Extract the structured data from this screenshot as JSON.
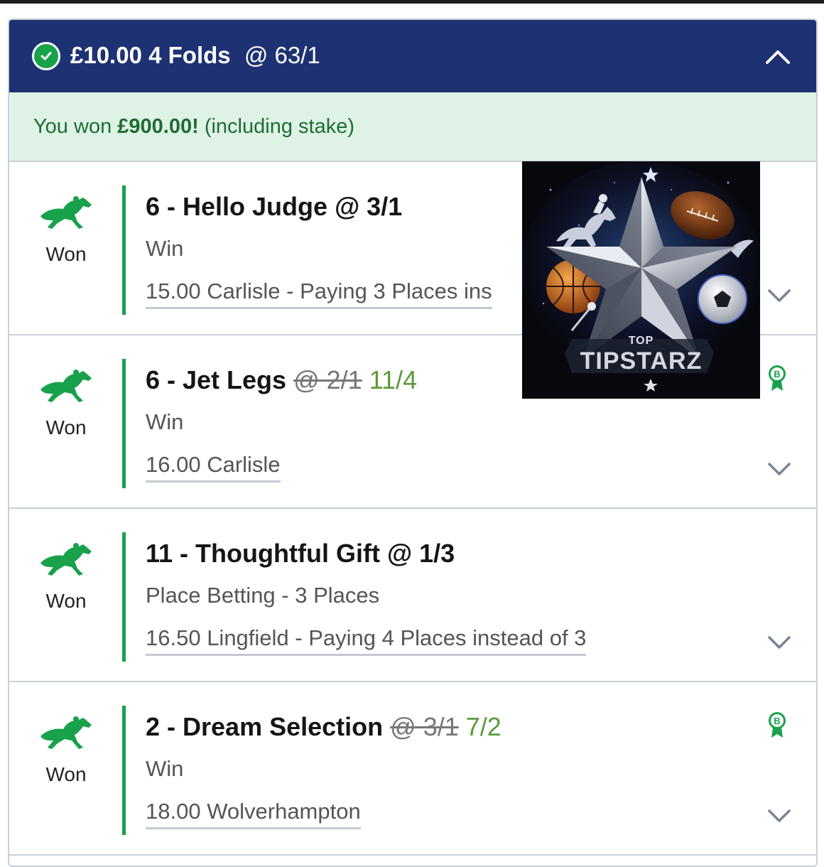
{
  "header": {
    "stake": "£10.00",
    "bet_type": "4 Folds",
    "odds": "@ 63/1"
  },
  "banner": {
    "prefix": "You won ",
    "amount": "£900.00!",
    "suffix": " (including stake)"
  },
  "legs": [
    {
      "status": "Won",
      "selection": "6 - Hello Judge",
      "odds": "@ 3/1",
      "market": "Win",
      "event": "15.00 Carlisle - Paying 3 Places ins"
    },
    {
      "status": "Won",
      "selection": "6 - Jet Legs",
      "old_odds": "@ 2/1",
      "new_odds": "11/4",
      "market": "Win",
      "event": "16.00 Carlisle",
      "boost_badge": "B"
    },
    {
      "status": "Won",
      "selection": "11 - Thoughtful Gift",
      "odds": "@ 1/3",
      "market": "Place Betting - 3 Places",
      "event": "16.50 Lingfield - Paying 4 Places instead of 3"
    },
    {
      "status": "Won",
      "selection": "2 - Dream Selection",
      "old_odds": "@ 3/1",
      "new_odds": "7/2",
      "market": "Win",
      "event": "18.00 Wolverhampton",
      "boost_badge": "B"
    }
  ],
  "overlay_logo": {
    "top": "TOP",
    "main": "TIPSTARZ"
  },
  "colors": {
    "header_bg": "#1e3273",
    "won_green": "#19a14b",
    "banner_bg": "#def3e6",
    "boosted_odds": "#5a9a3a"
  },
  "icons": {
    "leg_icon": "horse-racing-icon",
    "expand_icon": "chevron-down-icon",
    "collapse_icon": "chevron-up-icon",
    "status_icon": "check-circle-icon"
  }
}
